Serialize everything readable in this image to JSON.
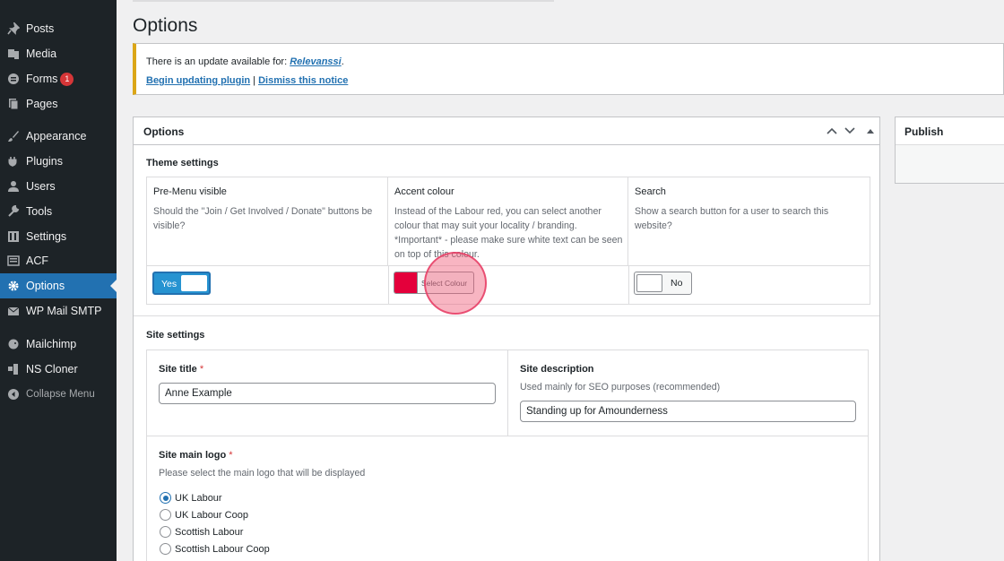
{
  "sidebar": {
    "items": [
      {
        "label": "Posts",
        "icon": "pin-icon"
      },
      {
        "label": "Media",
        "icon": "media-icon"
      },
      {
        "label": "Forms",
        "icon": "forms-icon",
        "badge": "1"
      },
      {
        "label": "Pages",
        "icon": "pages-icon"
      },
      {
        "label": "Appearance",
        "icon": "paintbrush-icon"
      },
      {
        "label": "Plugins",
        "icon": "plugin-icon"
      },
      {
        "label": "Users",
        "icon": "user-icon"
      },
      {
        "label": "Tools",
        "icon": "wrench-icon"
      },
      {
        "label": "Settings",
        "icon": "settings-icon"
      },
      {
        "label": "ACF",
        "icon": "acf-icon"
      },
      {
        "label": "Options",
        "icon": "gear-icon",
        "active": true
      },
      {
        "label": "WP Mail SMTP",
        "icon": "mail-icon"
      },
      {
        "label": "Mailchimp",
        "icon": "mailchimp-icon"
      },
      {
        "label": "NS Cloner",
        "icon": "cloner-icon"
      },
      {
        "label": "Collapse Menu",
        "icon": "collapse-icon"
      }
    ]
  },
  "page": {
    "title": "Options"
  },
  "notice": {
    "prefix": "There is an update available for: ",
    "plugin": "Relevanssi",
    "suffix": ".",
    "update_link": "Begin updating plugin",
    "separator": " | ",
    "dismiss_link": "Dismiss this notice"
  },
  "options_box": {
    "title": "Options",
    "theme_settings": {
      "title": "Theme settings",
      "columns": [
        {
          "label": "Pre-Menu visible",
          "description": "Should the \"Join / Get Involved / Donate\" buttons be visible?",
          "toggle": "Yes"
        },
        {
          "label": "Accent colour",
          "description": "Instead of the Labour red, you can select another colour that may suit your locality / branding. *Important* - please make sure white text can be seen on top of this colour.",
          "button": "Select Colour",
          "color": "#e4003b"
        },
        {
          "label": "Search",
          "description": "Show a search button for a user to search this website?",
          "toggle": "No"
        }
      ]
    },
    "site_settings": {
      "title": "Site settings",
      "site_title": {
        "label": "Site title",
        "required": "*",
        "value": "Anne Example"
      },
      "site_description": {
        "label": "Site description",
        "description": "Used mainly for SEO purposes (recommended)",
        "value": "Standing up for Amounderness"
      },
      "main_logo": {
        "label": "Site main logo",
        "required": "*",
        "description": "Please select the main logo that will be displayed",
        "options": [
          "UK Labour",
          "UK Labour Coop",
          "Scottish Labour",
          "Scottish Labour Coop"
        ],
        "selected": "UK Labour"
      }
    }
  },
  "publish_box": {
    "title": "Publish"
  },
  "colors": {
    "accent": "#2271b1",
    "sidebar_bg": "#1d2327",
    "notice_warning": "#dba617",
    "brand_red": "#e4003b"
  }
}
